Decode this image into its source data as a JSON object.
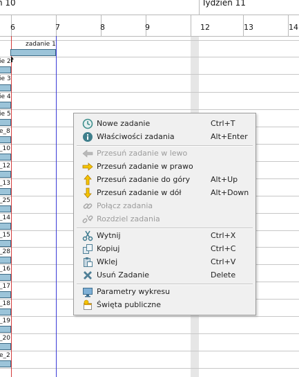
{
  "timeline": {
    "weeks": [
      {
        "label": "n 10"
      },
      {
        "label": "Tydzień 11"
      }
    ],
    "days": [
      "6",
      "7",
      "8",
      "9",
      "12",
      "13",
      "14"
    ]
  },
  "tasks": {
    "top_bar_label": "zadanie 1",
    "row_labels": [
      "ie 2",
      "ie 3",
      "ie 4",
      "ie 5",
      "e_8",
      "_10",
      "_12",
      "_13",
      "_25",
      "_14",
      "_15",
      "_28",
      "_16",
      "_17",
      "_18",
      "_19",
      "_20",
      "e_2"
    ]
  },
  "context_menu": {
    "items": [
      {
        "label": "Nowe zadanie",
        "shortcut": "Ctrl+T",
        "icon": "clock-icon",
        "enabled": true
      },
      {
        "label": "Właściwości zadania",
        "shortcut": "Alt+Enter",
        "icon": "info-icon",
        "enabled": true
      },
      {
        "label": "Przesuń zadanie w lewo",
        "shortcut": "",
        "icon": "arrow-left-icon",
        "enabled": false
      },
      {
        "label": "Przesuń zadanie w prawo",
        "shortcut": "",
        "icon": "arrow-right-icon",
        "enabled": true
      },
      {
        "label": "Przesuń zadanie do góry",
        "shortcut": "Alt+Up",
        "icon": "arrow-up-icon",
        "enabled": true
      },
      {
        "label": "Przesuń zadanie w dół",
        "shortcut": "Alt+Down",
        "icon": "arrow-down-icon",
        "enabled": true
      },
      {
        "label": "Połącz zadania",
        "shortcut": "",
        "icon": "link-icon",
        "enabled": false
      },
      {
        "label": "Rozdziel zadania",
        "shortcut": "",
        "icon": "unlink-icon",
        "enabled": false
      },
      {
        "label": "Wytnij",
        "shortcut": "Ctrl+X",
        "icon": "scissors-icon",
        "enabled": true
      },
      {
        "label": "Kopiuj",
        "shortcut": "Ctrl+C",
        "icon": "copy-icon",
        "enabled": true
      },
      {
        "label": "Wklej",
        "shortcut": "Ctrl+V",
        "icon": "paste-icon",
        "enabled": true
      },
      {
        "label": "Usuń Zadanie",
        "shortcut": "Delete",
        "icon": "delete-icon",
        "enabled": true
      },
      {
        "label": "Parametry wykresu",
        "shortcut": "",
        "icon": "monitor-icon",
        "enabled": true
      },
      {
        "label": "Święta publiczne",
        "shortcut": "",
        "icon": "holiday-icon",
        "enabled": true
      }
    ]
  },
  "colors": {
    "task_bar": "#9cc4d9",
    "today_line": "#d23a3a",
    "marker_line": "#3a3ad6",
    "menu_background": "#f0f0f0"
  }
}
